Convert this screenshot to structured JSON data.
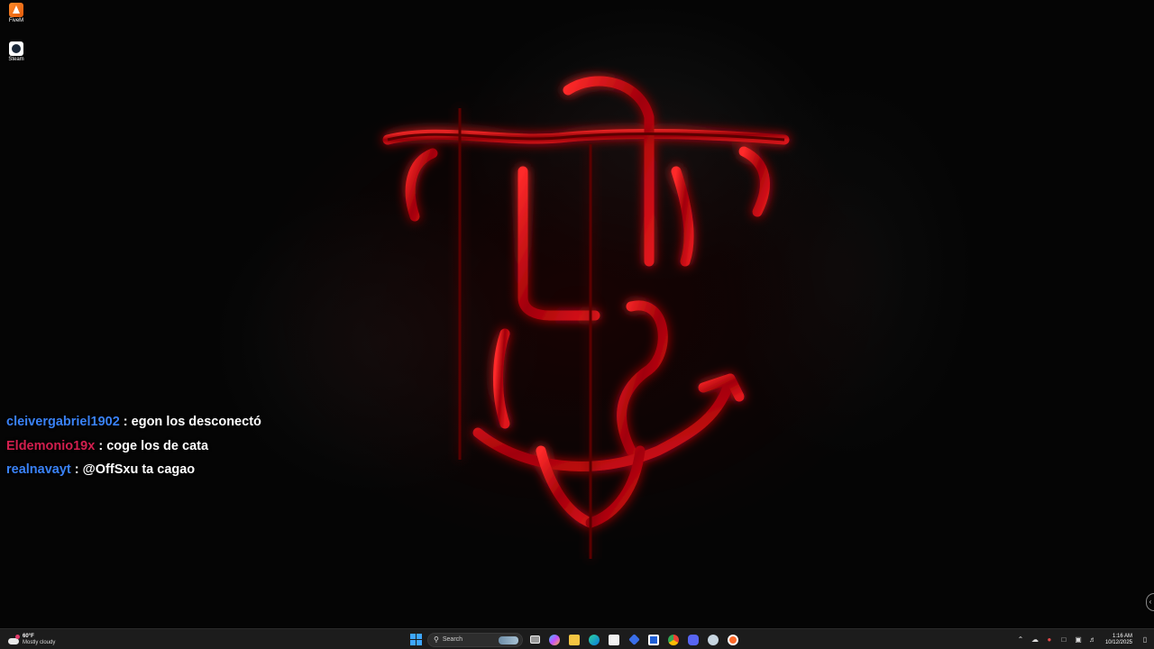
{
  "desktop": {
    "icons": [
      {
        "label": "FiveM",
        "icon": "fivem-icon"
      },
      {
        "label": "Steam",
        "icon": "steam-icon"
      }
    ]
  },
  "chat": [
    {
      "user": "cleivergabriel1902",
      "message": ": egon los desconectó",
      "user_color": "#3a82f7"
    },
    {
      "user": "Eldemonio19x",
      "message": ": coge los de cata",
      "user_color": "#d21f4e"
    },
    {
      "user": "realnavayt",
      "message": ": @OffSxu ta cagao",
      "user_color": "#3a82f7"
    }
  ],
  "taskbar": {
    "weather": {
      "temp": "60°F",
      "condition": "Mostly cloudy",
      "icon": "cloud-icon"
    },
    "search_placeholder": "Search",
    "pinned_icons": [
      "windows-start-icon",
      "search-icon",
      "task-view-icon",
      "copilot-icon",
      "file-explorer-icon",
      "edge-icon",
      "store-icon",
      "app-icon",
      "app-icon",
      "chrome-icon",
      "discord-icon",
      "steam-icon",
      "fivem-icon"
    ],
    "tray": {
      "clock_time": "1:16 AM",
      "clock_date": "10/12/2025"
    }
  },
  "colors": {
    "logo_red": "#c8070f",
    "taskbar_bg": "#1c1c1c",
    "chat_blue": "#3a82f7",
    "chat_red": "#d21f4e"
  }
}
